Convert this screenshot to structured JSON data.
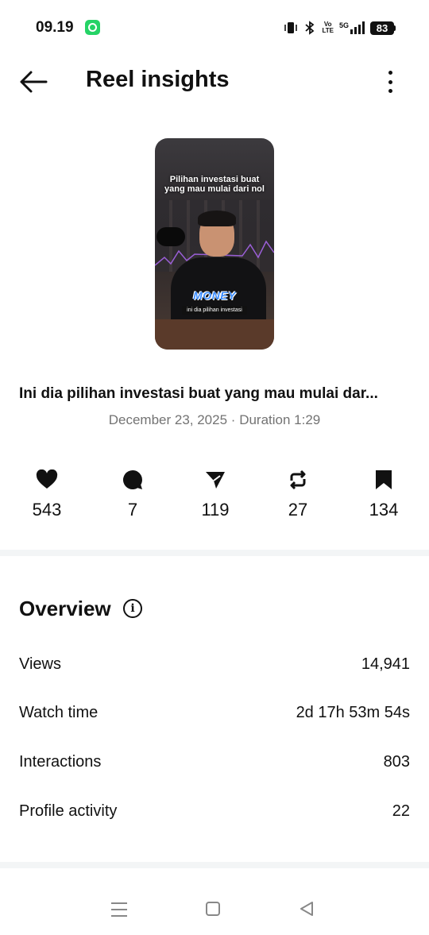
{
  "status_bar": {
    "time": "09.19",
    "icons": [
      "whatsapp-icon",
      "vibrate-icon",
      "bluetooth-icon",
      "volte-icon",
      "signal-5g-icon",
      "battery-icon"
    ],
    "volte_line1": "Vo",
    "volte_line2": "LTE",
    "network": "5G",
    "battery": "83"
  },
  "header": {
    "title": "Reel insights",
    "back_icon": "arrow-left-icon",
    "more_icon": "more-vertical-icon"
  },
  "reel": {
    "thumbnail_title": "Pilihan investasi buat yang mau mulai dari nol",
    "thumbnail_logo": "MONEY",
    "thumbnail_caption": "ini dia pilihan investasi",
    "caption": "Ini dia pilihan investasi buat yang mau mulai dar...",
    "date": "December 23, 2025",
    "separator": "·",
    "duration": "Duration 1:29"
  },
  "stats": [
    {
      "icon": "heart-icon",
      "value": "543"
    },
    {
      "icon": "comment-icon",
      "value": "7"
    },
    {
      "icon": "share-icon",
      "value": "119"
    },
    {
      "icon": "repost-icon",
      "value": "27"
    },
    {
      "icon": "bookmark-icon",
      "value": "134"
    }
  ],
  "overview": {
    "title": "Overview",
    "info_glyph": "i",
    "rows": [
      {
        "label": "Views",
        "value": "14,941"
      },
      {
        "label": "Watch time",
        "value": "2d 17h 53m 54s"
      },
      {
        "label": "Interactions",
        "value": "803"
      },
      {
        "label": "Profile activity",
        "value": "22"
      }
    ]
  },
  "nav": {
    "icons": [
      "recents-icon",
      "home-icon",
      "back-triangle-icon"
    ]
  },
  "colors": {
    "text": "#111111",
    "secondary_text": "#737373",
    "divider": "#f3f5f6",
    "whatsapp": "#25d366"
  }
}
